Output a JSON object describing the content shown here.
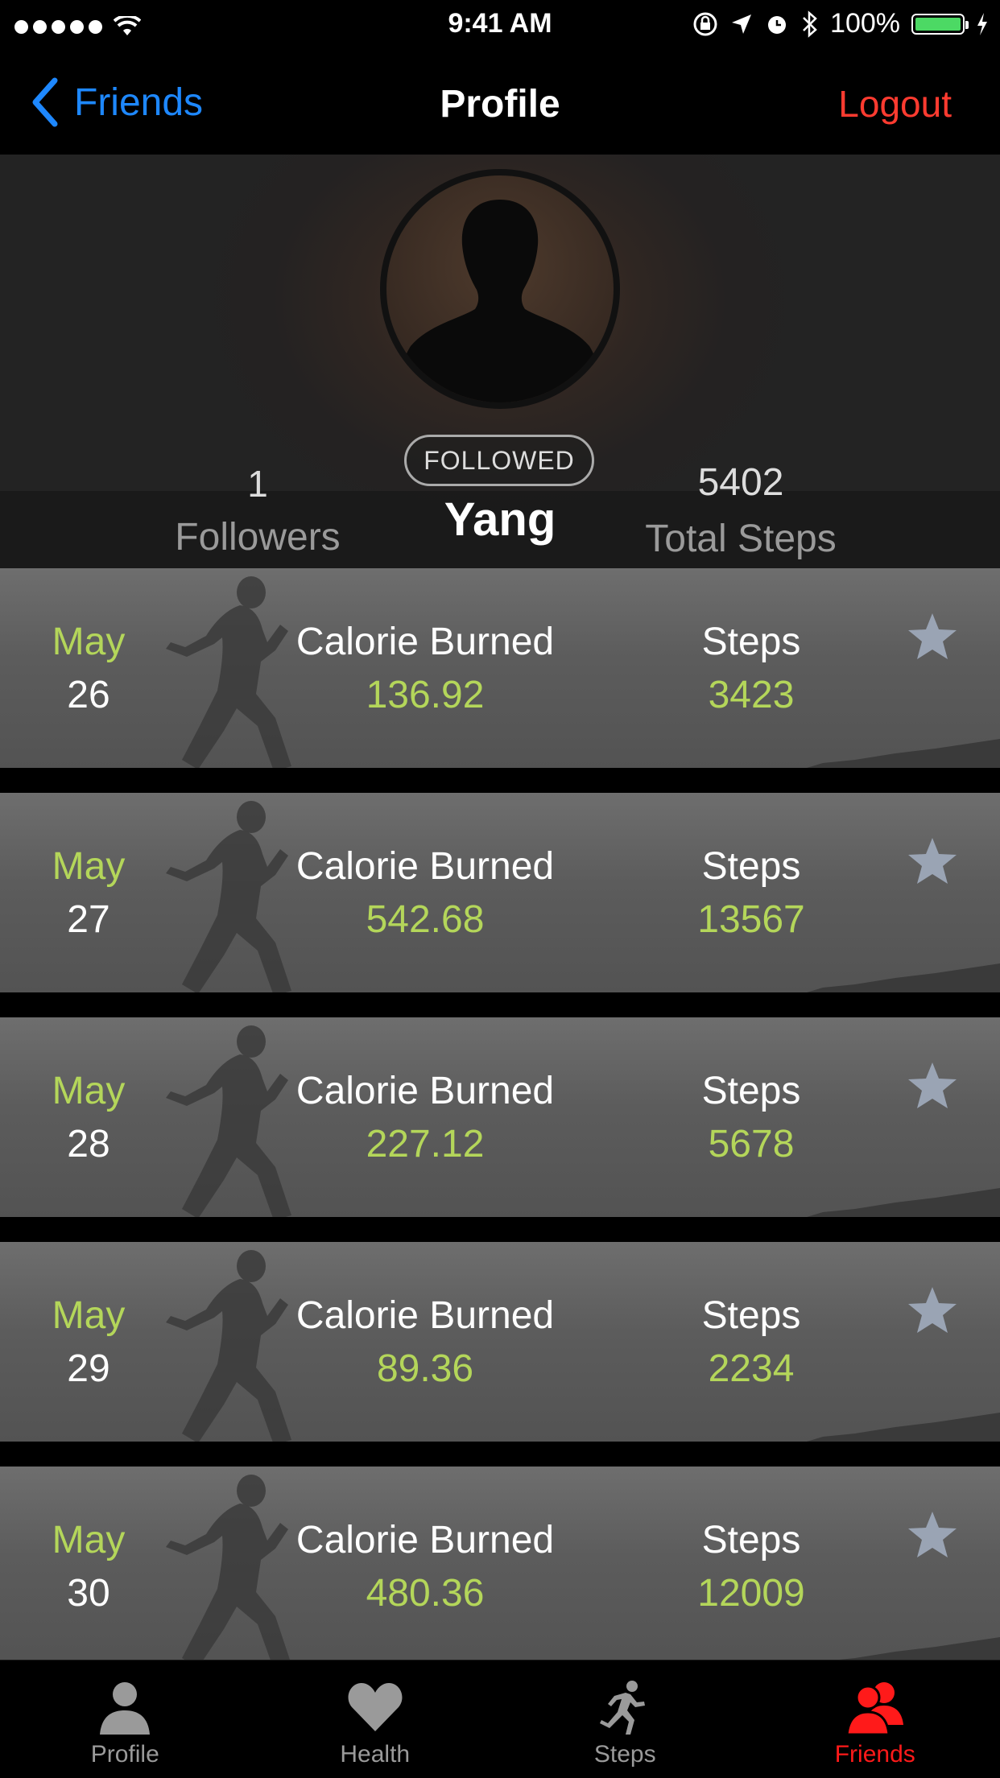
{
  "status_bar": {
    "time": "9:41 AM",
    "battery": "100%"
  },
  "nav": {
    "back_label": "Friends",
    "title": "Profile",
    "logout_label": "Logout",
    "back_color": "#1e88ff",
    "logout_color": "#ff3b30"
  },
  "profile": {
    "followed_label": "FOLLOWED",
    "name": "Yang",
    "followers_count": "1",
    "followers_label": "Followers",
    "total_steps": "5402",
    "total_steps_label": "Total Steps"
  },
  "activities": [
    {
      "month": "May",
      "day": "26",
      "calorie_label": "Calorie Burned",
      "calories": "136.92",
      "steps_label": "Steps",
      "steps": "3423"
    },
    {
      "month": "May",
      "day": "27",
      "calorie_label": "Calorie Burned",
      "calories": "542.68",
      "steps_label": "Steps",
      "steps": "13567"
    },
    {
      "month": "May",
      "day": "28",
      "calorie_label": "Calorie Burned",
      "calories": "227.12",
      "steps_label": "Steps",
      "steps": "5678"
    },
    {
      "month": "May",
      "day": "29",
      "calorie_label": "Calorie Burned",
      "calories": "89.36",
      "steps_label": "Steps",
      "steps": "2234"
    },
    {
      "month": "May",
      "day": "30",
      "calorie_label": "Calorie Burned",
      "calories": "480.36",
      "steps_label": "Steps",
      "steps": "12009"
    }
  ],
  "tabs": [
    {
      "label": "Profile",
      "icon": "person-icon",
      "active": false
    },
    {
      "label": "Health",
      "icon": "heart-icon",
      "active": false
    },
    {
      "label": "Steps",
      "icon": "runner-icon",
      "active": false
    },
    {
      "label": "Friends",
      "icon": "friends-icon",
      "active": true
    }
  ],
  "colors": {
    "accent_green": "#b4d65a",
    "active_tab": "#ff1a1a",
    "battery": "#4cd964"
  }
}
